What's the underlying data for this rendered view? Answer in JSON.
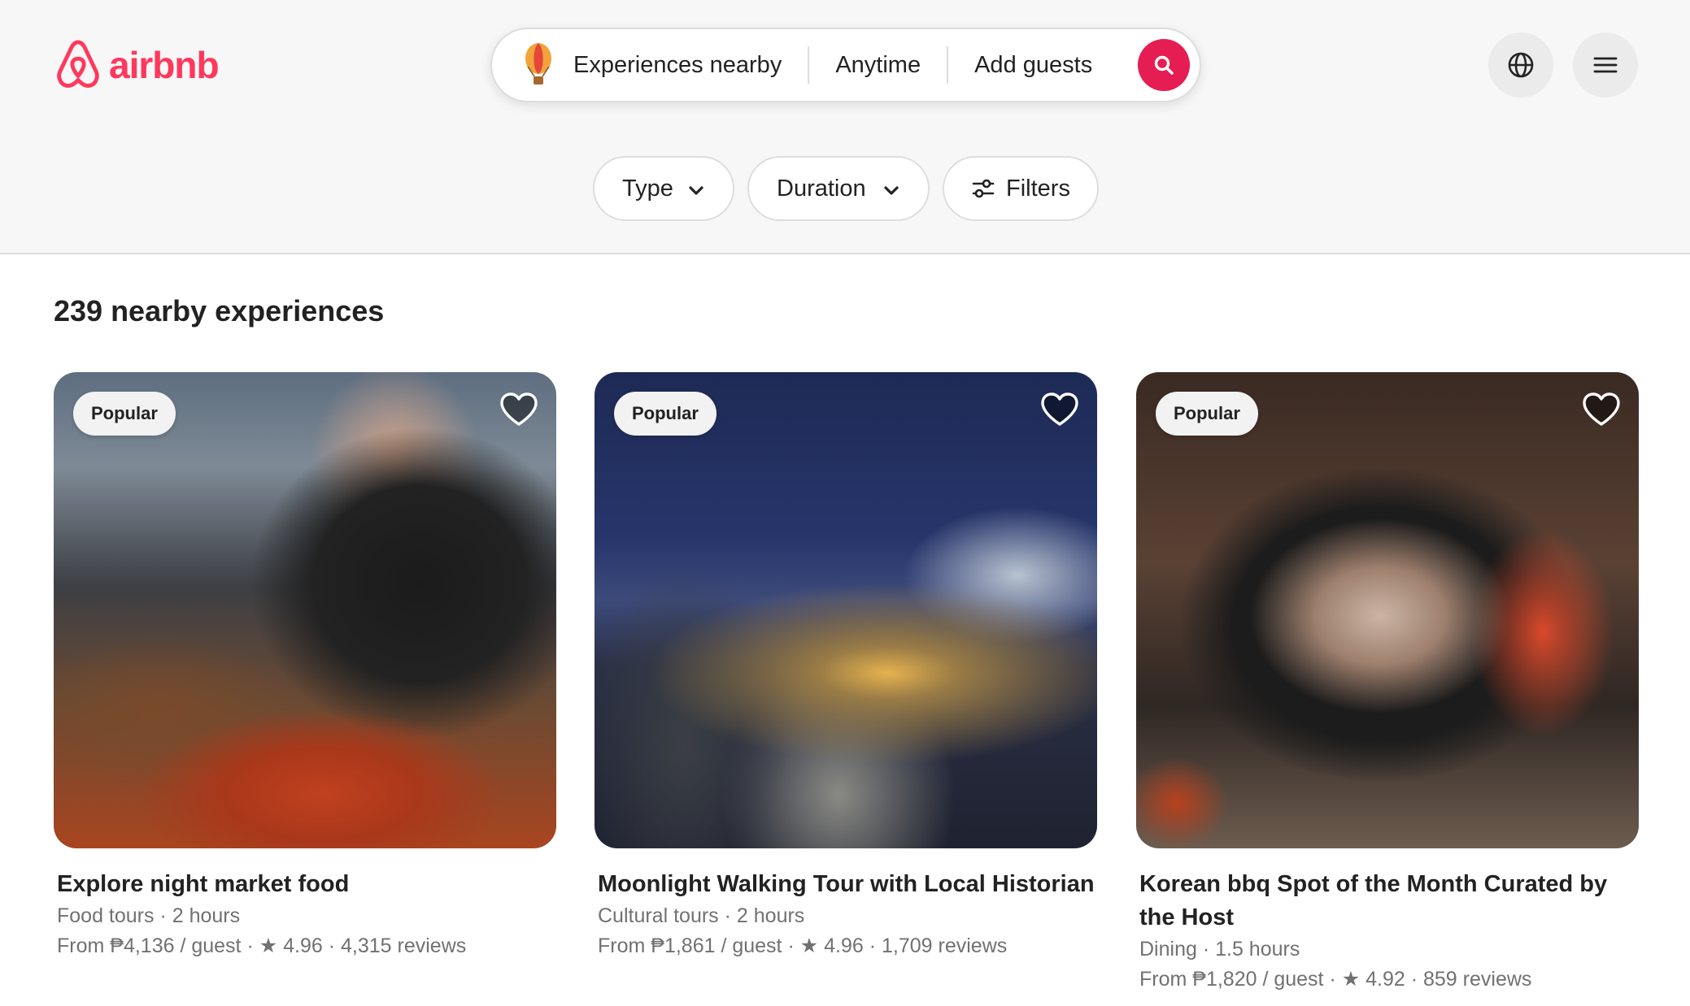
{
  "brand": {
    "name": "airbnb",
    "color": "#ff385c"
  },
  "search": {
    "where": "Experiences nearby",
    "when": "Anytime",
    "who": "Add guests",
    "button_color": "#e51d53",
    "icons": [
      "hot-air-balloon-icon",
      "search-icon"
    ]
  },
  "header_actions": [
    "globe-icon",
    "menu-icon"
  ],
  "filters": {
    "type_label": "Type",
    "duration_label": "Duration",
    "filters_label": "Filters"
  },
  "results": {
    "title": "239 nearby experiences"
  },
  "cards": [
    {
      "badge": "Popular",
      "title": "Explore night market food",
      "category": "Food tours",
      "duration": "2 hours",
      "price": "From ₱4,136 / guest",
      "rating": "★ 4.96",
      "reviews": "4,315 reviews"
    },
    {
      "badge": "Popular",
      "title": "Moonlight Walking Tour with Local Historian",
      "category": "Cultural tours",
      "duration": "2 hours",
      "price": "From ₱1,861 / guest",
      "rating": "★ 4.96",
      "reviews": "1,709 reviews"
    },
    {
      "badge": "Popular",
      "title": "Korean bbq Spot of the Month Curated by the Host",
      "category": "Dining",
      "duration": "1.5 hours",
      "price": "From ₱1,820 / guest",
      "rating": "★ 4.92",
      "reviews": "859 reviews"
    }
  ],
  "separator": "·"
}
